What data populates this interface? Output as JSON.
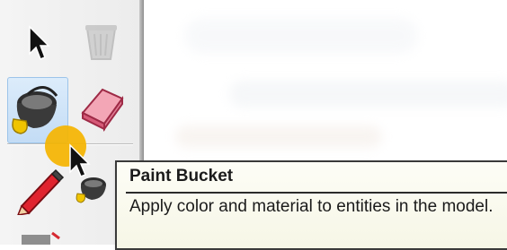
{
  "toolbar": {
    "tools": [
      {
        "name": "Select"
      },
      {
        "name": "Delete"
      },
      {
        "name": "Paint Bucket",
        "selected": true
      },
      {
        "name": "Eraser"
      },
      {
        "name": "Pencil"
      }
    ]
  },
  "tooltip": {
    "title": "Paint Bucket",
    "description": "Apply color and material to entities in the model."
  },
  "colors": {
    "tooltip_bg": "#f8f8ea",
    "selected_bg": "#cfe3f8",
    "highlight": "#f5b400"
  }
}
